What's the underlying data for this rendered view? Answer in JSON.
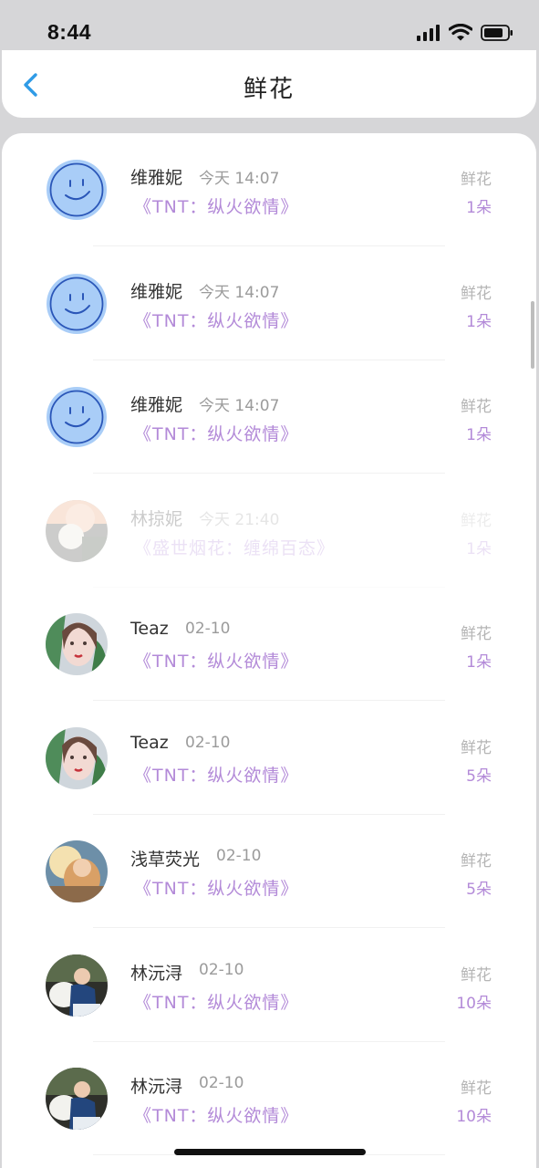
{
  "status_bar": {
    "time": "8:44"
  },
  "nav": {
    "title": "鲜花"
  },
  "gifts": [
    {
      "user": "维雅妮",
      "time": "今天 14:07",
      "gift": "《TNT：纵火欲情》",
      "label": "鲜花",
      "count": "1朵",
      "avatar": "smiley"
    },
    {
      "user": "维雅妮",
      "time": "今天 14:07",
      "gift": "《TNT：纵火欲情》",
      "label": "鲜花",
      "count": "1朵",
      "avatar": "smiley"
    },
    {
      "user": "维雅妮",
      "time": "今天 14:07",
      "gift": "《TNT：纵火欲情》",
      "label": "鲜花",
      "count": "1朵",
      "avatar": "smiley"
    },
    {
      "user": "林掠妮",
      "time": "今天 21:40",
      "gift": "《盛世烟花：缠绵百态》",
      "label": "鲜花",
      "count": "1朵",
      "avatar": "photo-orange"
    },
    {
      "user": "Teaz",
      "time": "02-10",
      "gift": "《TNT：纵火欲情》",
      "label": "鲜花",
      "count": "1朵",
      "avatar": "illustration-girl"
    },
    {
      "user": "Teaz",
      "time": "02-10",
      "gift": "《TNT：纵火欲情》",
      "label": "鲜花",
      "count": "5朵",
      "avatar": "illustration-girl"
    },
    {
      "user": "浅草荧光",
      "time": "02-10",
      "gift": "《TNT：纵火欲情》",
      "label": "鲜花",
      "count": "5朵",
      "avatar": "photo-sunlight"
    },
    {
      "user": "林沅浔",
      "time": "02-10",
      "gift": "《TNT：纵火欲情》",
      "label": "鲜花",
      "count": "10朵",
      "avatar": "photo-dog"
    },
    {
      "user": "林沅浔",
      "time": "02-10",
      "gift": "《TNT：纵火欲情》",
      "label": "鲜花",
      "count": "10朵",
      "avatar": "photo-dog"
    }
  ],
  "colors": {
    "accent_purple": "#b38ad8",
    "back_blue": "#2f9be6",
    "smiley_fill": "#a9cdf7",
    "smiley_line": "#2a56b8"
  }
}
